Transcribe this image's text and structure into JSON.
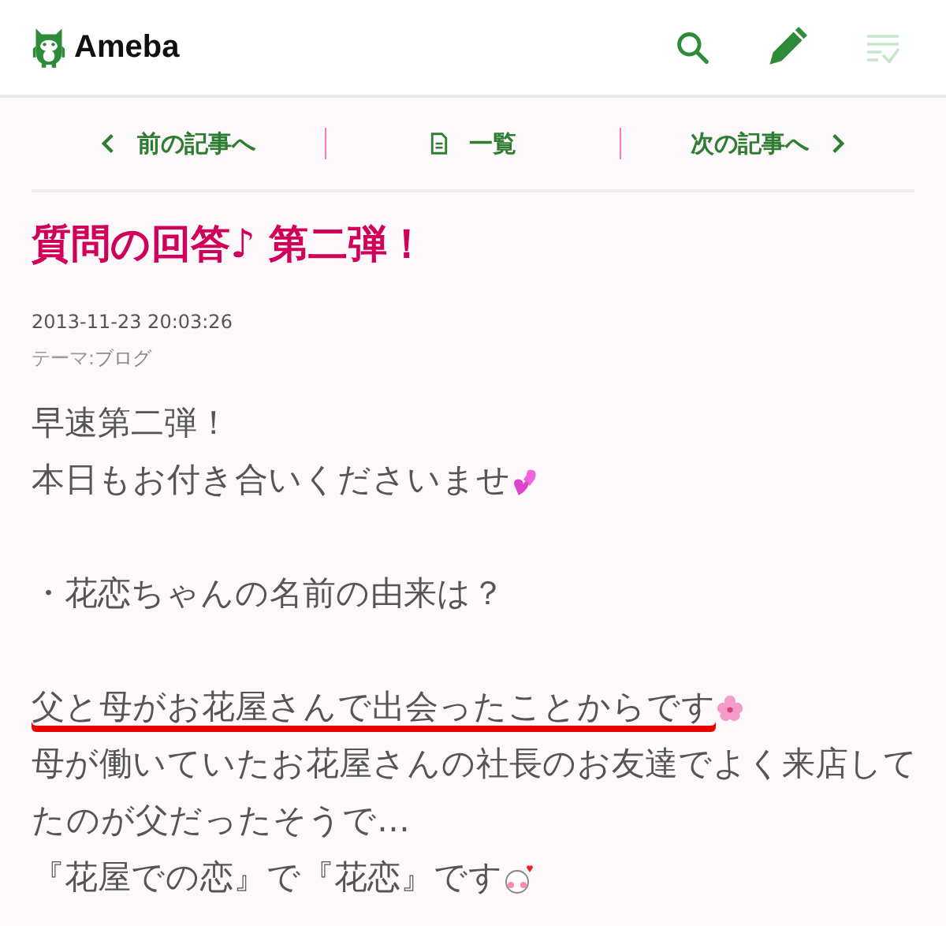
{
  "header": {
    "logo": "Ameba",
    "tools": [
      {
        "kind": "search",
        "disabled": false
      },
      {
        "kind": "write",
        "disabled": false
      },
      {
        "kind": "list",
        "disabled": true
      }
    ]
  },
  "nav": {
    "prev": "前の記事へ",
    "list": "一覧",
    "next": "次の記事へ"
  },
  "article": {
    "title": "質問の回答♪ 第二弾！",
    "date": "2013-11-23 20:03:26",
    "theme_label": "テーマ:",
    "theme": "ブログ",
    "lines": [
      {
        "kind": "text",
        "text": "早速第二弾！",
        "underlined": false
      },
      {
        "kind": "text",
        "text": "本日もお付き合いくださいませ",
        "emoji": {
          "kind": "hearts"
        },
        "underlined": false
      },
      {
        "kind": "blank"
      },
      {
        "kind": "text",
        "text": "・花恋ちゃんの名前の由来は？",
        "underlined": false
      },
      {
        "kind": "blank"
      },
      {
        "kind": "text",
        "text": "父と母がお花屋さんで出会ったことからです",
        "emoji": {
          "kind": "flower"
        },
        "underlined": true
      },
      {
        "kind": "text",
        "text": "母が働いていたお花屋さんの社長のお友達でよく来店してたのが父だったそうで…",
        "underlined": false
      },
      {
        "kind": "text",
        "text": "『花屋での恋』で『花恋』です",
        "emoji": {
          "kind": "face"
        },
        "underlined": false
      }
    ]
  }
}
